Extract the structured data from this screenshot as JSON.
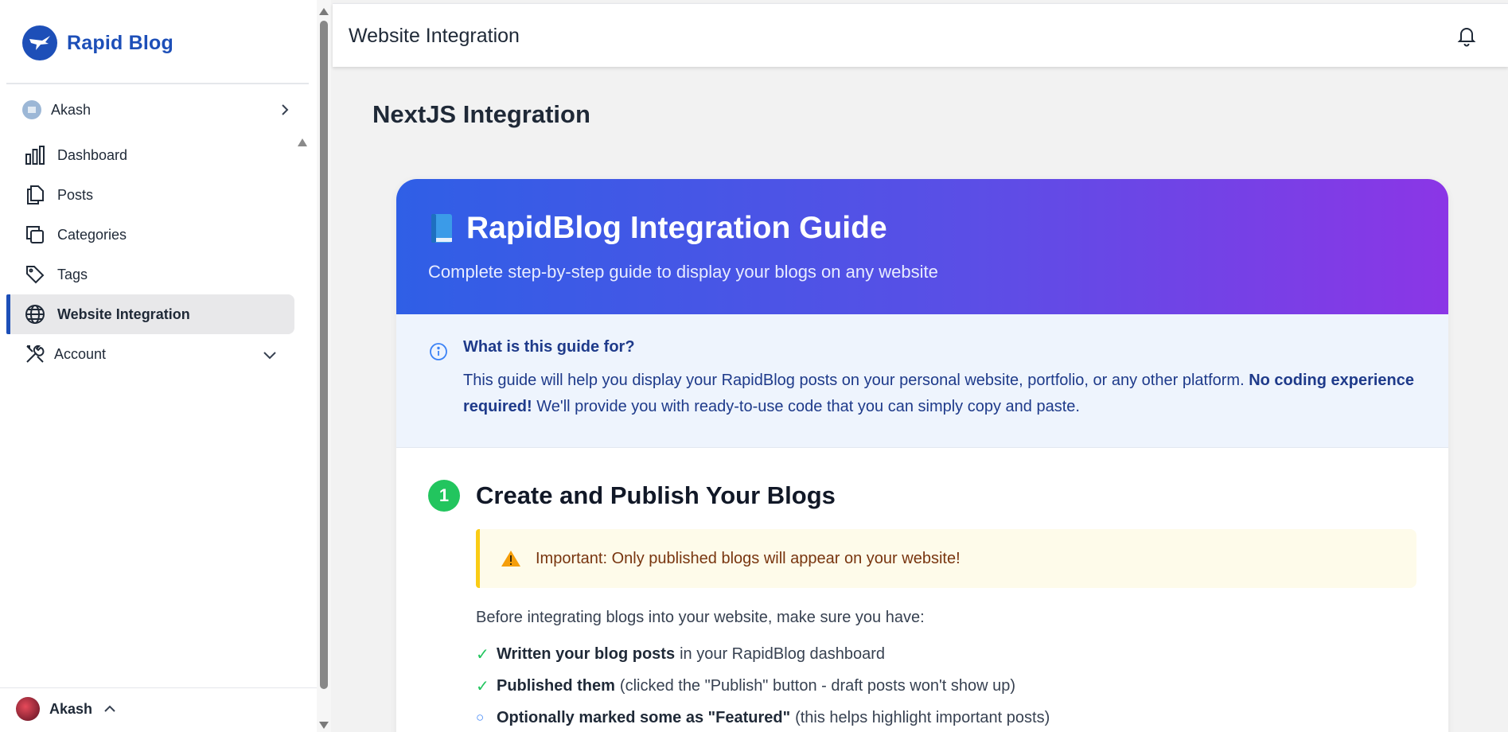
{
  "brand": {
    "name": "Rapid Blog",
    "color": "#1d4fb8"
  },
  "org": {
    "name": "Akash"
  },
  "nav": {
    "items": [
      {
        "label": "Dashboard",
        "icon": "bar-chart-icon"
      },
      {
        "label": "Posts",
        "icon": "documents-icon"
      },
      {
        "label": "Categories",
        "icon": "stacked-squares-icon"
      },
      {
        "label": "Tags",
        "icon": "tag-icon"
      },
      {
        "label": "Website Integration",
        "icon": "globe-icon",
        "active": true
      },
      {
        "label": "Account",
        "icon": "tools-icon"
      }
    ]
  },
  "user": {
    "name": "Akash"
  },
  "header": {
    "title": "Website Integration"
  },
  "page": {
    "title": "NextJS Integration"
  },
  "guide": {
    "title": "RapidBlog Integration Guide",
    "subtitle": "Complete step-by-step guide to display your blogs on any website",
    "info": {
      "title": "What is this guide for?",
      "text_part1": "This guide will help you display your RapidBlog posts on your personal website, portfolio, or any other platform. ",
      "text_bold": "No coding experience required!",
      "text_part2": " We'll provide you with ready-to-use code that you can simply copy and paste."
    },
    "step1": {
      "number": "1",
      "title": "Create and Publish Your Blogs",
      "warning": "Important: Only published blogs will appear on your website!",
      "intro": "Before integrating blogs into your website, make sure you have:",
      "checklist": [
        {
          "mark": "✓",
          "bold": "Written your blog posts",
          "text": "in your RapidBlog dashboard"
        },
        {
          "mark": "✓",
          "bold": "Published them",
          "text": "(clicked the \"Publish\" button - draft posts won't show up)"
        },
        {
          "mark": "○",
          "bold": "Optionally marked some as \"Featured\"",
          "text": "(this helps highlight important posts)"
        }
      ]
    }
  }
}
